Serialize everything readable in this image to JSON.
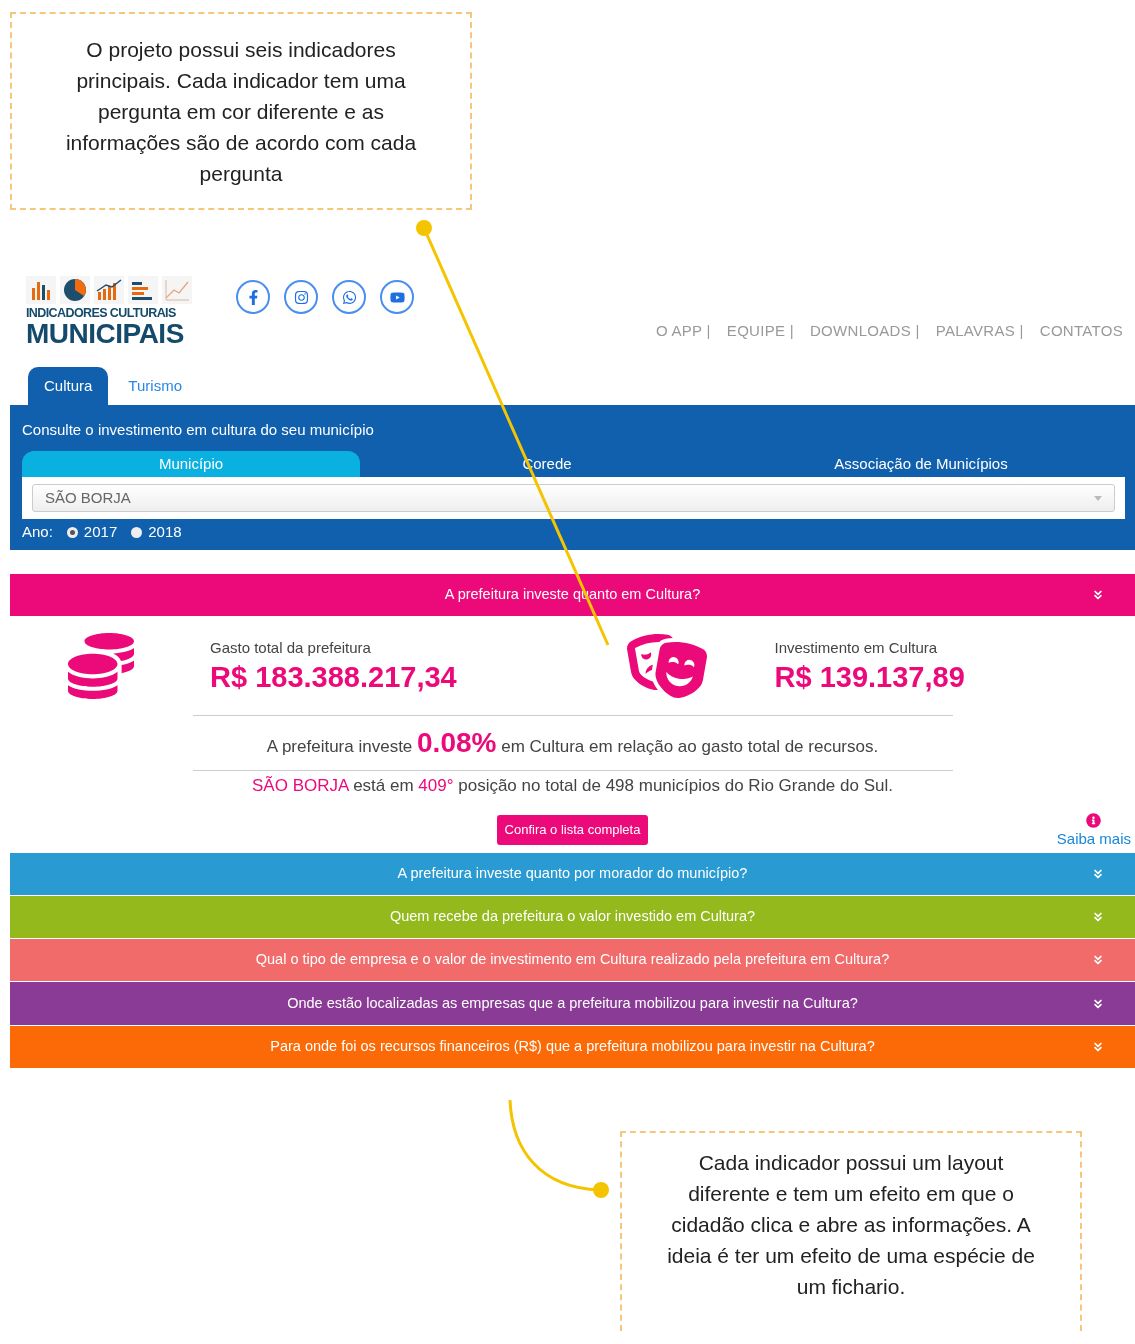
{
  "annotations": [
    {
      "text": "O projeto possui seis indicadores principais. Cada indicador tem uma pergunta em cor diferente e as informações são de acordo com cada pergunta"
    },
    {
      "text": "Cada indicador possui um layout diferente e tem um efeito em que o cidadão clica e abre as informações. A ideia é ter um efeito de uma espécie de um fichario."
    }
  ],
  "logo": {
    "line1": "INDICADORES CULTURAIS",
    "line2": "MUNICIPAIS"
  },
  "nav": [
    "O APP |",
    "EQUIPE |",
    "DOWNLOADS |",
    "PALAVRAS |",
    "CONTATOS"
  ],
  "tabs": [
    {
      "label": "Cultura",
      "selected": true
    },
    {
      "label": "Turismo",
      "selected": false
    }
  ],
  "panel": {
    "title": "Consulte o investimento em cultura do seu município",
    "subtabs": [
      {
        "label": "Município",
        "selected": true
      },
      {
        "label": "Corede",
        "selected": false
      },
      {
        "label": "Associação de Municípios",
        "selected": false
      }
    ],
    "select_value": "SÃO BORJA",
    "year_label": "Ano:",
    "years": [
      {
        "label": "2017",
        "selected": true
      },
      {
        "label": "2018",
        "selected": false
      }
    ]
  },
  "indicators": [
    {
      "question": "A prefeitura investe quanto em Cultura?",
      "color": "#ec0a7a",
      "open": true
    },
    {
      "question": "A prefeitura investe quanto por morador do município?",
      "color": "#2a9bd2"
    },
    {
      "question": "Quem recebe da prefeitura o valor investido em Cultura?",
      "color": "#93b91d"
    },
    {
      "question": "Qual o tipo de empresa e o valor de investimento em Cultura realizado pela prefeitura em Cultura?",
      "color": "#f26b6b"
    },
    {
      "question": "Onde estão localizadas as empresas que a prefeitura mobilizou para investir na Cultura?",
      "color": "#8a3b95"
    },
    {
      "question": "Para onde foi os recursos financeiros (R$) que a prefeitura mobilizou para investir na Cultura?",
      "color": "#fb6a07"
    }
  ],
  "detail": {
    "stats": [
      {
        "label": "Gasto total da prefeitura",
        "value": "R$ 183.388.217,34",
        "kind": "coins"
      },
      {
        "label": "Investimento em Cultura",
        "value": "R$ 139.137,89",
        "kind": "masks"
      }
    ],
    "share_sentence": [
      {
        "text": "A prefeitura investe ",
        "highlight": false
      },
      {
        "text": "0.08%",
        "highlight": true
      },
      {
        "text": " em Cultura em relação ao gasto total de recursos.",
        "highlight": false
      }
    ],
    "rank_sentence": [
      {
        "text": "SÃO BORJA",
        "highlight": true
      },
      {
        "text": " está em ",
        "highlight": false
      },
      {
        "text": "409°",
        "highlight": true
      },
      {
        "text": " posição no total de 498 municípios do Rio Grande do Sul.",
        "highlight": false
      }
    ],
    "button": "Confira o lista completa",
    "more": "Saiba mais"
  }
}
